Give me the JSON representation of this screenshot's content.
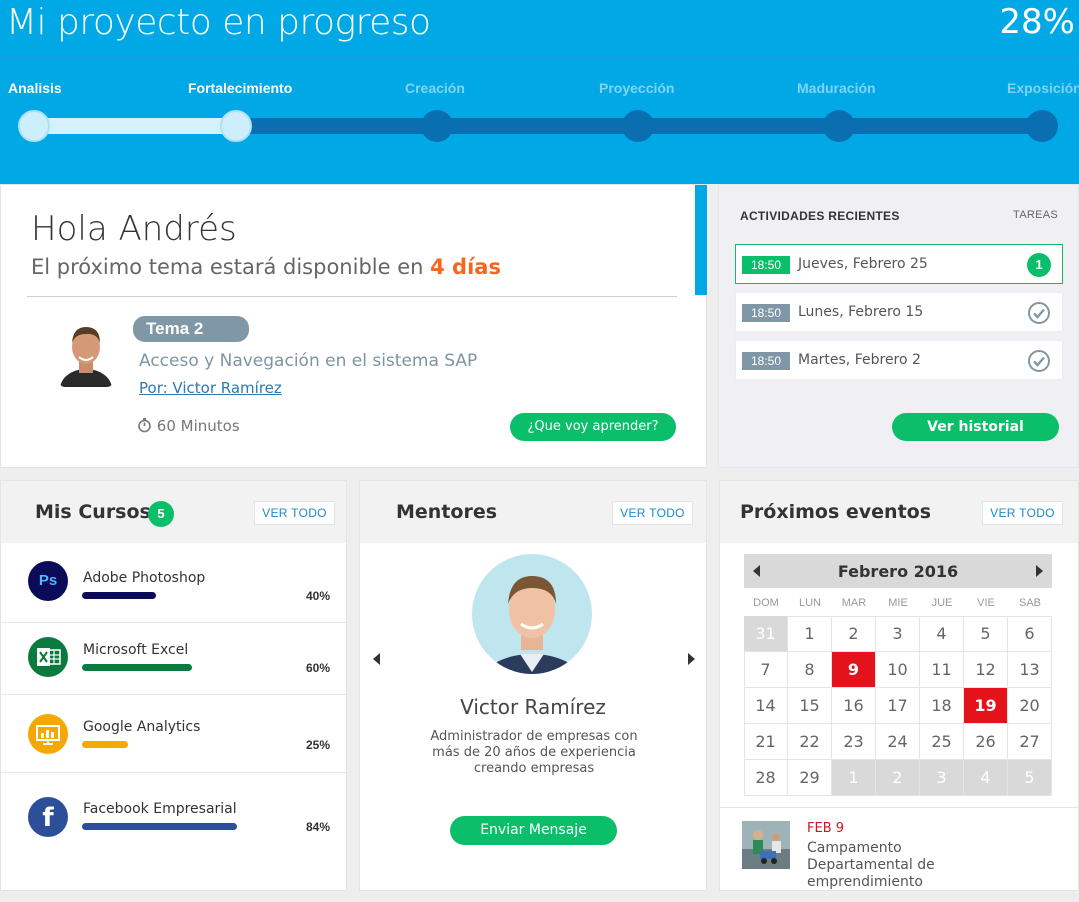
{
  "project": {
    "title": "Mi proyecto en progreso",
    "progress_label": "28%",
    "progress": 0.28,
    "stages": [
      {
        "label": "Analisis",
        "state": "done"
      },
      {
        "label": "Fortalecimiento",
        "state": "current"
      },
      {
        "label": "Creación",
        "state": "pending"
      },
      {
        "label": "Proyección",
        "state": "pending"
      },
      {
        "label": "Maduración",
        "state": "pending"
      },
      {
        "label": "Exposición",
        "state": "pending"
      }
    ]
  },
  "welcome": {
    "greeting": "Hola Andrés",
    "next_topic_prefix": "El próximo tema estará disponible en",
    "next_topic_days": "4 días",
    "topic_badge": "Tema 2",
    "topic_title": "Acceso y Navegación en el sistema SAP",
    "topic_author": "Por: Victor Ramírez",
    "duration": "60 Minutos",
    "learn_button": "¿Que voy aprender?"
  },
  "activities": {
    "title": "ACTIVIDADES RECIENTES",
    "link": "TAREAS",
    "items": [
      {
        "time": "18:50",
        "date": "Jueves, Febrero 25",
        "status": "1",
        "active": true
      },
      {
        "time": "18:50",
        "date": "Lunes, Febrero 15",
        "status": "done",
        "active": false
      },
      {
        "time": "18:50",
        "date": "Martes, Febrero 2",
        "status": "done",
        "active": false
      }
    ],
    "history_button": "Ver historial"
  },
  "courses": {
    "title": "Mis Cursos",
    "count": "5",
    "view_all": "VER TODO",
    "items": [
      {
        "name": "Adobe Photoshop",
        "pct_label": "40%",
        "progress": 0.4,
        "icon": "photoshop-icon",
        "color": "#0b0b5a"
      },
      {
        "name": "Microsoft Excel",
        "pct_label": "60%",
        "progress": 0.6,
        "icon": "excel-icon",
        "color": "#0a7a3e"
      },
      {
        "name": "Google Analytics",
        "pct_label": "25%",
        "progress": 0.25,
        "icon": "analytics-icon",
        "color": "#f6a800"
      },
      {
        "name": "Facebook Empresarial",
        "pct_label": "84%",
        "progress": 0.84,
        "icon": "facebook-icon",
        "color": "#2d4f9a"
      }
    ]
  },
  "mentors": {
    "title": "Mentores",
    "view_all": "VER TODO",
    "name": "Victor Ramírez",
    "description": "Administrador de empresas con más de 20 años de experiencia creando empresas",
    "message_button": "Enviar Mensaje"
  },
  "events": {
    "title": "Próximos eventos",
    "view_all": "VER TODO",
    "month": "Febrero 2016",
    "weekdays": [
      "DOM",
      "LUN",
      "MAR",
      "MIE",
      "JUE",
      "VIE",
      "SAB"
    ],
    "weeks": [
      [
        [
          "31",
          "other"
        ],
        [
          "1",
          ""
        ],
        [
          "2",
          ""
        ],
        [
          "3",
          ""
        ],
        [
          "4",
          ""
        ],
        [
          "5",
          ""
        ],
        [
          "6",
          ""
        ]
      ],
      [
        [
          "7",
          ""
        ],
        [
          "8",
          ""
        ],
        [
          "9",
          "event"
        ],
        [
          "10",
          ""
        ],
        [
          "11",
          ""
        ],
        [
          "12",
          ""
        ],
        [
          "13",
          ""
        ]
      ],
      [
        [
          "14",
          ""
        ],
        [
          "15",
          ""
        ],
        [
          "16",
          ""
        ],
        [
          "17",
          ""
        ],
        [
          "18",
          ""
        ],
        [
          "19",
          "event"
        ],
        [
          "20",
          ""
        ]
      ],
      [
        [
          "21",
          ""
        ],
        [
          "22",
          ""
        ],
        [
          "23",
          ""
        ],
        [
          "24",
          ""
        ],
        [
          "25",
          ""
        ],
        [
          "26",
          ""
        ],
        [
          "27",
          ""
        ]
      ],
      [
        [
          "28",
          ""
        ],
        [
          "29",
          ""
        ],
        [
          "1",
          "other"
        ],
        [
          "2",
          "other"
        ],
        [
          "3",
          "other"
        ],
        [
          "4",
          "other"
        ],
        [
          "5",
          "other"
        ]
      ]
    ],
    "event_date": "FEB 9",
    "event_title": "Campamento Departamental de emprendimiento"
  },
  "colors": {
    "brand_blue": "#00a9e6",
    "track_blue": "#0a6fb0",
    "green": "#0bbf6a",
    "orange": "#f4671f",
    "event_red": "#e3121b"
  }
}
